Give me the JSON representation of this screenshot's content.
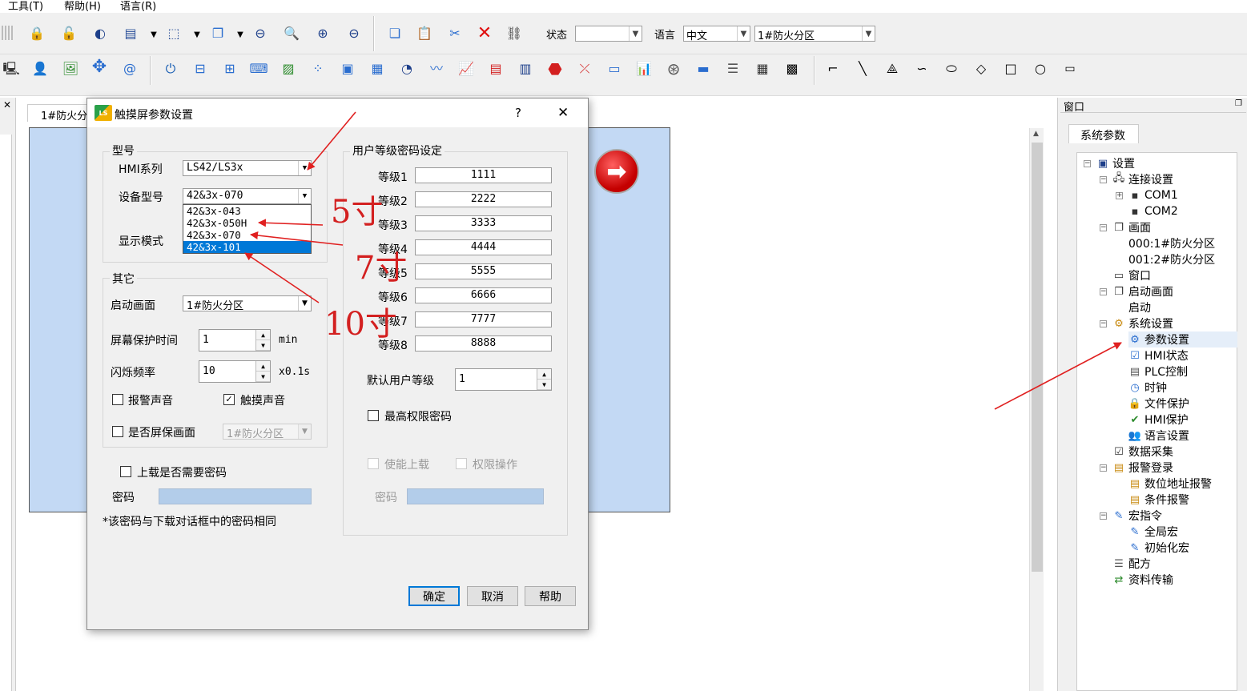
{
  "menu": {
    "tools": "工具(T)",
    "help": "帮助(H)",
    "language": "语言(R)"
  },
  "toolbar": {
    "state_label": "状态",
    "state_value": "",
    "lang_label": "语言",
    "lang_value": "中文",
    "screen_value": "1#防火分区"
  },
  "doc_tab": "1#防火分",
  "right_panel": {
    "title": "窗口",
    "tab": "系统参数"
  },
  "tree": [
    {
      "label": "设置",
      "icon": "monitor-icon"
    },
    {
      "label": "连接设置",
      "icon": "network-icon"
    },
    {
      "label": "COM1",
      "icon": "port-icon"
    },
    {
      "label": "COM2",
      "icon": "port-icon"
    },
    {
      "label": "画面",
      "icon": "screens-icon"
    },
    {
      "label": "000:1#防火分区",
      "icon": ""
    },
    {
      "label": "001:2#防火分区",
      "icon": ""
    },
    {
      "label": "窗口",
      "icon": "window-icon"
    },
    {
      "label": "启动画面",
      "icon": "screens-icon"
    },
    {
      "label": "启动",
      "icon": ""
    },
    {
      "label": "系统设置",
      "icon": "gear-folder-icon"
    },
    {
      "label": "参数设置",
      "icon": "gear-icon"
    },
    {
      "label": "HMI状态",
      "icon": "status-icon"
    },
    {
      "label": "PLC控制",
      "icon": "plc-icon"
    },
    {
      "label": "时钟",
      "icon": "clock-icon"
    },
    {
      "label": "文件保护",
      "icon": "lock-icon"
    },
    {
      "label": "HMI保护",
      "icon": "shield-icon"
    },
    {
      "label": "语言设置",
      "icon": "people-icon"
    },
    {
      "label": "数据采集",
      "icon": "data-icon"
    },
    {
      "label": "报警登录",
      "icon": "alarm-icon"
    },
    {
      "label": "数位地址报警",
      "icon": "alarm-icon"
    },
    {
      "label": "条件报警",
      "icon": "alarm-icon"
    },
    {
      "label": "宏指令",
      "icon": "macro-icon"
    },
    {
      "label": "全局宏",
      "icon": "macro-icon"
    },
    {
      "label": "初始化宏",
      "icon": "macro-icon"
    },
    {
      "label": "配方",
      "icon": "recipe-icon"
    },
    {
      "label": "资料传输",
      "icon": "transfer-icon"
    }
  ],
  "dialog": {
    "title": "触摸屏参数设置",
    "help_glyph": "?",
    "close_glyph": "✕",
    "model_group": "型号",
    "hmi_series_label": "HMI系列",
    "hmi_series_value": "LS42/LS3x",
    "device_model_label": "设备型号",
    "device_model_value": "42&3x-070",
    "device_model_options": [
      "42&3x-043",
      "42&3x-050H",
      "42&3x-070",
      "42&3x-101"
    ],
    "display_mode_label": "显示模式",
    "other_group": "其它",
    "start_screen_label": "启动画面",
    "start_screen_value": "1#防火分区",
    "saver_time_label": "屏幕保护时间",
    "saver_time_value": "1",
    "saver_time_unit": "min",
    "blink_label": "闪烁频率",
    "blink_value": "10",
    "blink_unit": "x0.1s",
    "alarm_sound_label": "报警声音",
    "touch_sound_label": "触摸声音",
    "saver_screen_label": "是否屏保画面",
    "saver_screen_value": "1#防火分区",
    "upload_pwd_label": "上载是否需要密码",
    "pwd_label": "密码",
    "note": "*该密码与下载对话框中的密码相同",
    "user_group": "用户等级密码设定",
    "levels": [
      {
        "label": "等级1",
        "value": "1111"
      },
      {
        "label": "等级2",
        "value": "2222"
      },
      {
        "label": "等级3",
        "value": "3333"
      },
      {
        "label": "等级4",
        "value": "4444"
      },
      {
        "label": "等级5",
        "value": "5555"
      },
      {
        "label": "等级6",
        "value": "6666"
      },
      {
        "label": "等级7",
        "value": "7777"
      },
      {
        "label": "等级8",
        "value": "8888"
      }
    ],
    "default_level_label": "默认用户等级",
    "default_level_value": "1",
    "max_pwd_label": "最高权限密码",
    "enable_upload_label": "使能上载",
    "perm_op_label": "权限操作",
    "pwd2_label": "密码",
    "ok": "确定",
    "cancel": "取消",
    "help": "帮助"
  },
  "annotations": {
    "five": "5寸",
    "seven": "7寸",
    "ten": "10寸"
  }
}
